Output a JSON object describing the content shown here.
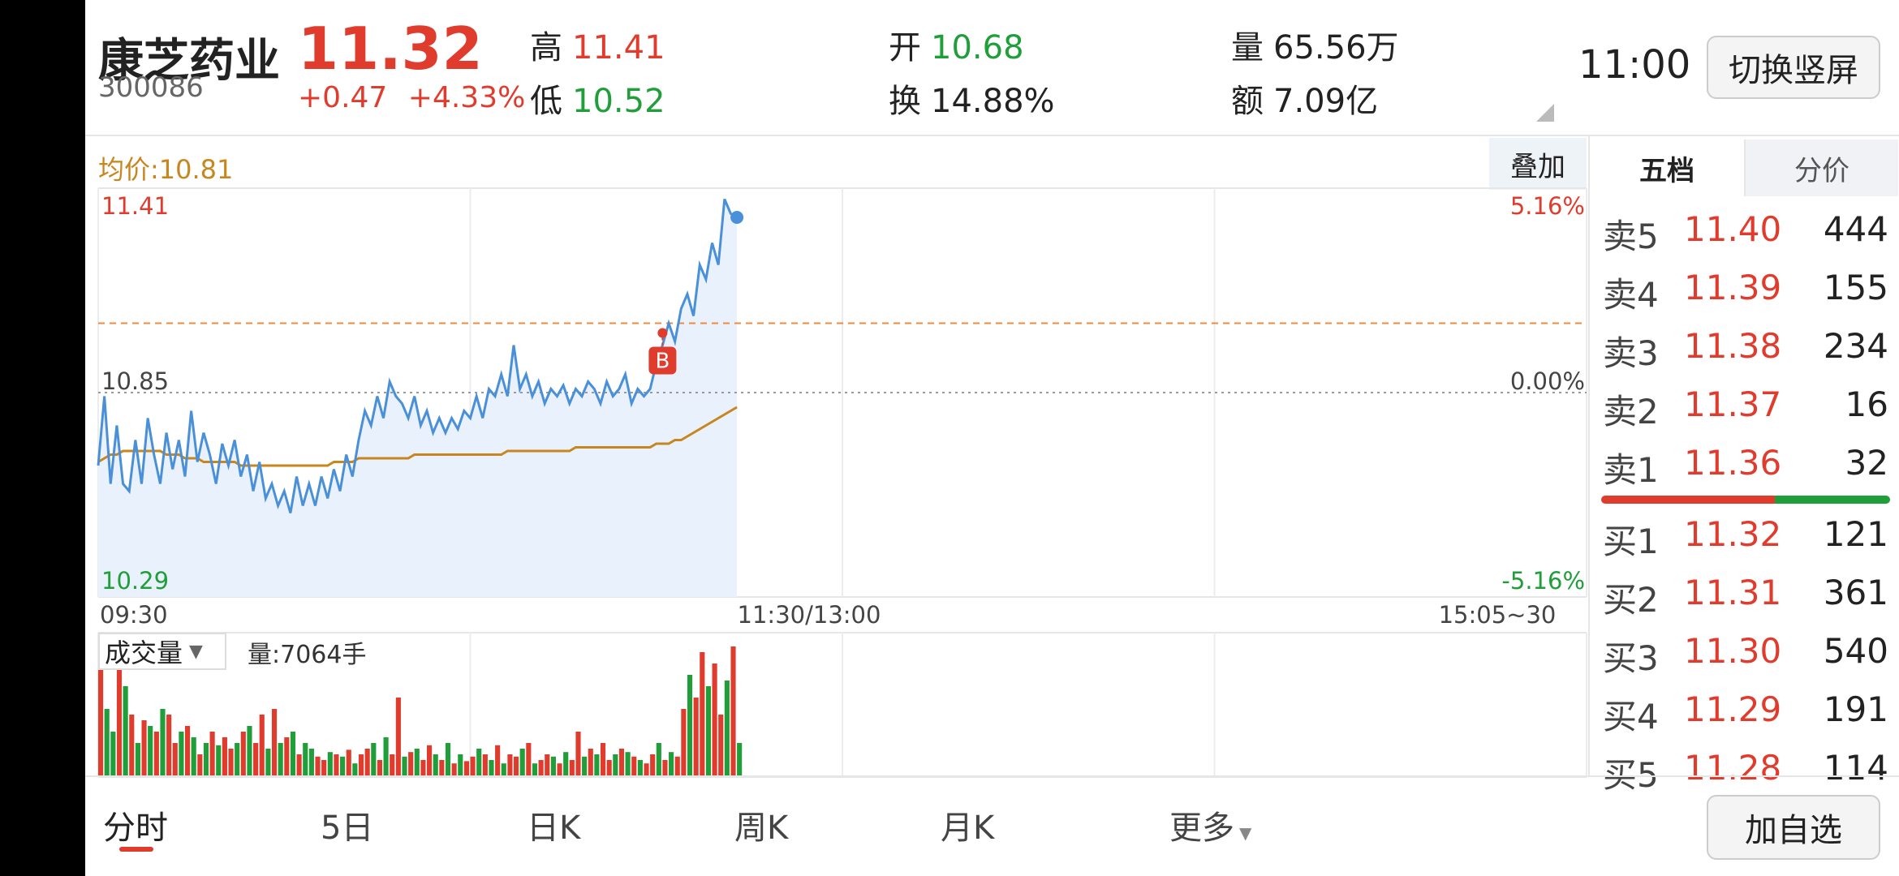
{
  "stock": {
    "name": "康芝药业",
    "code": "300086",
    "price": "11.32",
    "change": "+0.47",
    "change_pct": "+4.33%"
  },
  "stats": {
    "high_label": "高",
    "high": "11.41",
    "low_label": "低",
    "low": "10.52",
    "open_label": "开",
    "open": "10.68",
    "turnover_label": "换",
    "turnover": "14.88%",
    "volume_label": "量",
    "volume": "65.56万",
    "amount_label": "额",
    "amount": "7.09亿"
  },
  "time": "11:00",
  "buttons": {
    "switch": "切换竖屏",
    "overlay": "叠加",
    "add_watch": "加自选"
  },
  "chart": {
    "avg_price": "均价:10.81",
    "y_top": "11.41",
    "y_mid": "10.85",
    "y_bot": "10.29",
    "pct_top": "5.16%",
    "pct_mid": "0.00%",
    "pct_bot": "-5.16%",
    "x_start": "09:30",
    "x_mid": "11:30/13:00",
    "x_end": "15:05~30",
    "buy_marker": "B"
  },
  "volume": {
    "selector": "成交量",
    "text": "量:7064手"
  },
  "orderbook": {
    "tabs": [
      "五档",
      "分价"
    ],
    "asks": [
      {
        "label": "卖5",
        "price": "11.40",
        "vol": "444"
      },
      {
        "label": "卖4",
        "price": "11.39",
        "vol": "155"
      },
      {
        "label": "卖3",
        "price": "11.38",
        "vol": "234"
      },
      {
        "label": "卖2",
        "price": "11.37",
        "vol": "16"
      },
      {
        "label": "卖1",
        "price": "11.36",
        "vol": "32"
      }
    ],
    "bids": [
      {
        "label": "买1",
        "price": "11.32",
        "vol": "121"
      },
      {
        "label": "买2",
        "price": "11.31",
        "vol": "361"
      },
      {
        "label": "买3",
        "price": "11.30",
        "vol": "540"
      },
      {
        "label": "买4",
        "price": "11.29",
        "vol": "191"
      },
      {
        "label": "买5",
        "price": "11.28",
        "vol": "114"
      }
    ],
    "bid_ask_ratio": 0.6
  },
  "nav": [
    "分时",
    "5日",
    "日K",
    "周K",
    "月K",
    "更多"
  ],
  "colors": {
    "up": "#e03c2d",
    "down": "#1f9e3a",
    "price_line": "#4a90d9",
    "avg_line": "#c8861e",
    "prev_close_line": "#f08a3c"
  },
  "chart_data": {
    "type": "line",
    "prev_close": 10.85,
    "ylim": [
      10.29,
      11.41
    ],
    "series": [
      {
        "values": [
          10.65,
          10.84,
          10.6,
          10.76,
          10.6,
          10.58,
          10.72,
          10.6,
          10.78,
          10.68,
          10.6,
          10.74,
          10.64,
          10.72,
          10.62,
          10.8,
          10.66,
          10.74,
          10.68,
          10.6,
          10.71,
          10.65,
          10.72,
          10.62,
          10.68,
          10.58,
          10.66,
          10.56,
          10.6,
          10.54,
          10.58,
          10.52,
          10.62,
          10.54,
          10.6,
          10.54,
          10.62,
          10.56,
          10.64,
          10.58,
          10.68,
          10.62,
          10.72,
          10.8,
          10.76,
          10.84,
          10.78,
          10.88,
          10.84,
          10.82,
          10.78,
          10.84,
          10.76,
          10.8,
          10.74,
          10.78,
          10.74,
          10.78,
          10.75,
          10.8,
          10.78,
          10.84,
          10.78,
          10.86,
          10.84,
          10.9,
          10.84,
          10.98,
          10.86,
          10.9,
          10.84,
          10.88,
          10.82,
          10.86,
          10.84,
          10.87,
          10.82,
          10.86,
          10.84,
          10.88,
          10.86,
          10.82,
          10.88,
          10.84,
          10.86,
          10.9,
          10.82,
          10.86,
          10.84,
          10.86,
          10.93,
          10.98,
          11.04,
          10.99,
          11.08,
          11.12,
          11.06,
          11.2,
          11.16,
          11.26,
          11.2,
          11.38,
          11.34,
          11.33
        ]
      },
      {
        "values": [
          10.66,
          10.67,
          10.68,
          10.68,
          10.69,
          10.69,
          10.69,
          10.69,
          10.69,
          10.69,
          10.69,
          10.68,
          10.68,
          10.68,
          10.67,
          10.67,
          10.67,
          10.66,
          10.66,
          10.66,
          10.66,
          10.66,
          10.66,
          10.65,
          10.65,
          10.65,
          10.65,
          10.65,
          10.65,
          10.65,
          10.65,
          10.65,
          10.65,
          10.65,
          10.65,
          10.65,
          10.65,
          10.65,
          10.66,
          10.66,
          10.66,
          10.66,
          10.67,
          10.67,
          10.67,
          10.67,
          10.67,
          10.67,
          10.67,
          10.67,
          10.67,
          10.68,
          10.68,
          10.68,
          10.68,
          10.68,
          10.68,
          10.68,
          10.68,
          10.68,
          10.68,
          10.68,
          10.68,
          10.68,
          10.68,
          10.68,
          10.69,
          10.69,
          10.69,
          10.69,
          10.69,
          10.69,
          10.69,
          10.69,
          10.69,
          10.69,
          10.69,
          10.7,
          10.7,
          10.7,
          10.7,
          10.7,
          10.7,
          10.7,
          10.7,
          10.7,
          10.7,
          10.7,
          10.7,
          10.7,
          10.71,
          10.71,
          10.71,
          10.72,
          10.72,
          10.73,
          10.74,
          10.75,
          10.76,
          10.77,
          10.78,
          10.79,
          10.8,
          10.81
        ]
      }
    ],
    "volume": [
      120,
      60,
      40,
      110,
      80,
      55,
      30,
      50,
      45,
      40,
      60,
      55,
      30,
      40,
      45,
      35,
      20,
      30,
      40,
      28,
      35,
      25,
      30,
      40,
      45,
      30,
      55,
      25,
      60,
      30,
      35,
      40,
      20,
      30,
      25,
      18,
      15,
      22,
      20,
      18,
      24,
      12,
      20,
      25,
      30,
      15,
      35,
      20,
      70,
      18,
      22,
      25,
      15,
      28,
      20,
      15,
      30,
      12,
      20,
      14,
      18,
      25,
      20,
      15,
      28,
      12,
      20,
      18,
      25,
      30,
      12,
      15,
      20,
      18,
      12,
      22,
      15,
      40,
      18,
      25,
      20,
      30,
      15,
      20,
      25,
      22,
      18,
      15,
      12,
      20,
      30,
      15,
      22,
      18,
      60,
      90,
      70,
      110,
      80,
      100,
      55,
      85,
      115,
      30
    ],
    "volume_up": [
      1,
      0,
      0,
      1,
      0,
      1,
      0,
      1,
      0,
      1,
      0,
      1,
      1,
      0,
      1,
      0,
      1,
      0,
      1,
      0,
      1,
      1,
      0,
      1,
      0,
      1,
      1,
      0,
      1,
      0,
      1,
      0,
      1,
      0,
      0,
      1,
      1,
      0,
      1,
      0,
      1,
      0,
      1,
      1,
      0,
      1,
      0,
      1,
      1,
      0,
      1,
      0,
      1,
      1,
      0,
      1,
      0,
      1,
      0,
      1,
      1,
      0,
      1,
      0,
      1,
      0,
      1,
      1,
      0,
      1,
      0,
      1,
      1,
      0,
      1,
      0,
      1,
      1,
      0,
      1,
      0,
      1,
      1,
      0,
      1,
      0,
      1,
      0,
      1,
      1,
      0,
      1,
      0,
      1,
      1,
      0,
      1,
      1,
      0,
      1,
      1,
      0,
      1,
      0
    ]
  }
}
